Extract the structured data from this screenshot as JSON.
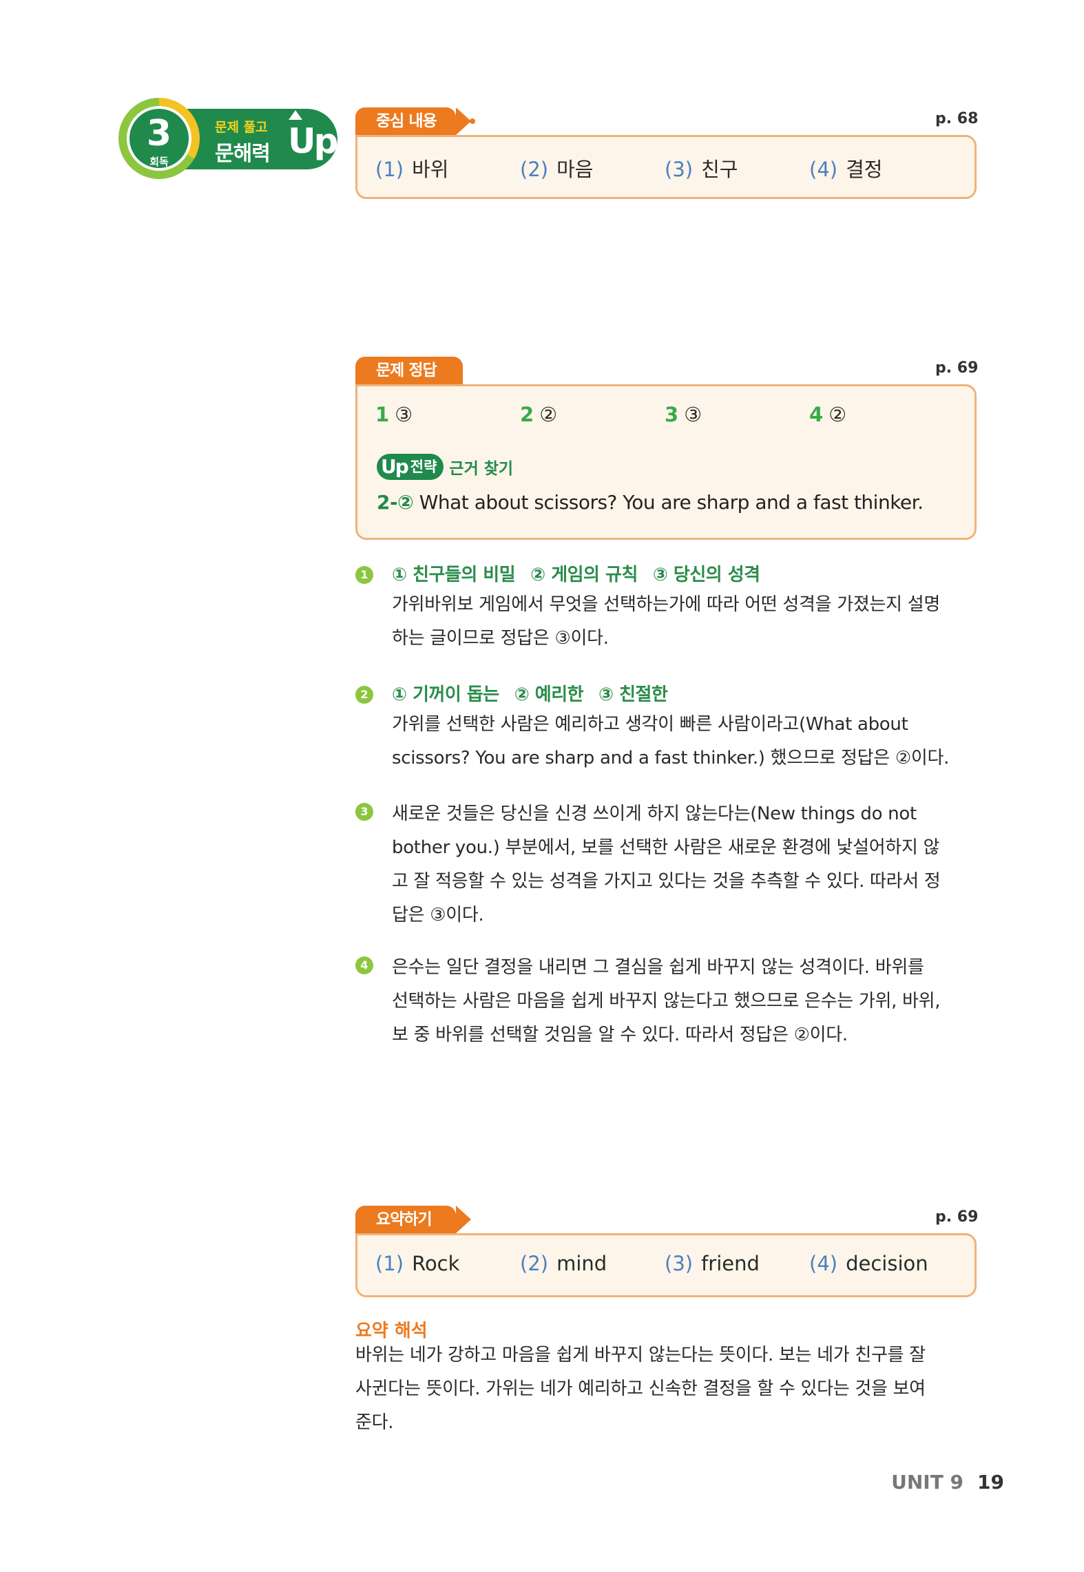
{
  "badge": {
    "round_number": "3",
    "round_label": "회독",
    "line1": "문제 풀고",
    "line2": "문해력",
    "up": "Up"
  },
  "section1": {
    "tab": "중심 내용",
    "page": "p. 68",
    "items": [
      {
        "num": "(1)",
        "text": "바위"
      },
      {
        "num": "(2)",
        "text": "마음"
      },
      {
        "num": "(3)",
        "text": "친구"
      },
      {
        "num": "(4)",
        "text": "결정"
      }
    ]
  },
  "section2": {
    "tab": "문제 정답",
    "page": "p. 69",
    "answers": [
      {
        "num": "1",
        "ans": "③"
      },
      {
        "num": "2",
        "ans": "②"
      },
      {
        "num": "3",
        "ans": "③"
      },
      {
        "num": "4",
        "ans": "②"
      }
    ],
    "strategy_up": "Up",
    "strategy_pill": "전략",
    "strategy_label": "근거 찾기",
    "evidence_prefix": "2-②",
    "evidence_text": "What about scissors? You are sharp and a fast thinker."
  },
  "explanations": [
    {
      "num": "1",
      "choices": [
        "① 친구들의 비밀",
        "② 게임의 규칙",
        "③ 당신의 성격"
      ],
      "lines": [
        "가위바위보 게임에서 무엇을 선택하는가에 따라 어떤 성격을 가졌는지 설명",
        "하는 글이므로 정답은 ③이다."
      ]
    },
    {
      "num": "2",
      "choices": [
        "① 기꺼이 돕는",
        "② 예리한",
        "③ 친절한"
      ],
      "lines": [
        "가위를 선택한 사람은 예리하고 생각이 빠른 사람이라고(What about",
        "scissors? You are sharp and a fast thinker.) 했으므로 정답은 ②이다."
      ]
    },
    {
      "num": "3",
      "choices": [],
      "lines": [
        "새로운 것들은 당신을 신경 쓰이게 하지 않는다는(New things do not",
        "bother you.) 부분에서, 보를 선택한 사람은 새로운 환경에 낯설어하지 않",
        "고 잘 적응할 수 있는 성격을 가지고 있다는 것을 추측할 수 있다. 따라서 정",
        "답은 ③이다."
      ]
    },
    {
      "num": "4",
      "choices": [],
      "lines": [
        "은수는 일단 결정을 내리면 그 결심을 쉽게 바꾸지 않는 성격이다. 바위를",
        "선택하는 사람은 마음을 쉽게 바꾸지 않는다고 했으므로 은수는 가위, 바위,",
        "보 중 바위를 선택할 것임을 알 수 있다. 따라서 정답은 ②이다."
      ]
    }
  ],
  "section3": {
    "tab": "요약하기",
    "page": "p. 69",
    "items": [
      {
        "num": "(1)",
        "text": "Rock"
      },
      {
        "num": "(2)",
        "text": "mind"
      },
      {
        "num": "(3)",
        "text": "friend"
      },
      {
        "num": "(4)",
        "text": "decision"
      }
    ]
  },
  "summary": {
    "title": "요약 해석",
    "lines": [
      "바위는 네가 강하고 마음을 쉽게 바꾸지 않는다는 뜻이다. 보는 네가 친구를 잘",
      "사귄다는 뜻이다. 가위는 네가 예리하고 신속한 결정을 할 수 있다는 것을 보여",
      "준다."
    ]
  },
  "footer": {
    "unit": "UNIT 9",
    "page": "19"
  },
  "colors": {
    "orange": "#ec7a1f",
    "green": "#1f8a4c",
    "light_green": "#8cc63f",
    "box_bg": "#fdf5e9",
    "box_border": "#f0b27a",
    "num_blue": "#4a7fc1"
  }
}
